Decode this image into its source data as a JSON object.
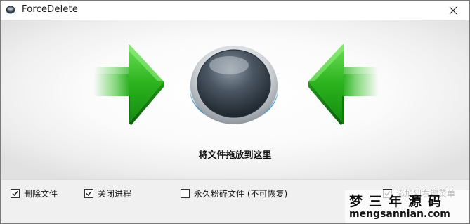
{
  "window": {
    "title": "ForceDelete",
    "close_glyph": "✕"
  },
  "drop_zone": {
    "label": "将文件拖放到这里",
    "left_arrow_icon": "arrow-right-green-icon",
    "right_arrow_icon": "arrow-left-green-icon",
    "center_icon": "drop-button-icon"
  },
  "options": [
    {
      "label": "删除文件",
      "checked": true
    },
    {
      "label": "关闭进程",
      "checked": true
    },
    {
      "label": "永久粉碎文件 (不可恢复)",
      "checked": false
    },
    {
      "label": "添加到右键菜单",
      "checked": true
    }
  ],
  "watermark": {
    "cn": "梦三年源码",
    "en": "mengsannian.com"
  },
  "colors": {
    "arrow_green": "#27b21a",
    "arrow_green_dark": "#0f7a0c",
    "button_ring": "#3aa8d6"
  }
}
